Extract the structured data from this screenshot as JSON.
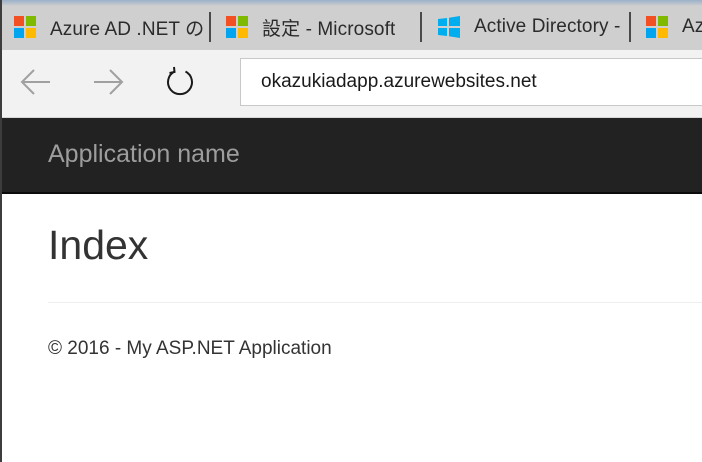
{
  "tabs": [
    {
      "label": "Azure AD .NET の",
      "icon": "microsoft-logo-icon"
    },
    {
      "label": "設定 - Microsoft",
      "icon": "microsoft-logo-icon"
    },
    {
      "label": "Active Directory -",
      "icon": "windows-logo-icon"
    },
    {
      "label": "Az",
      "icon": "microsoft-logo-icon"
    }
  ],
  "nav": {
    "back_icon": "back-arrow-icon",
    "forward_icon": "forward-arrow-icon",
    "refresh_icon": "refresh-icon"
  },
  "address": {
    "url": "okazukiadapp.azurewebsites.net"
  },
  "app": {
    "brand": "Application name",
    "title": "Index",
    "footer": "© 2016 - My ASP.NET Application"
  },
  "colors": {
    "ms_red": "#f25022",
    "ms_green": "#7fba00",
    "ms_blue": "#00a4ef",
    "ms_yellow": "#ffb900",
    "win_blue": "#00adef",
    "app_navbar": "#222222",
    "brand_text": "#9d9d9d"
  }
}
